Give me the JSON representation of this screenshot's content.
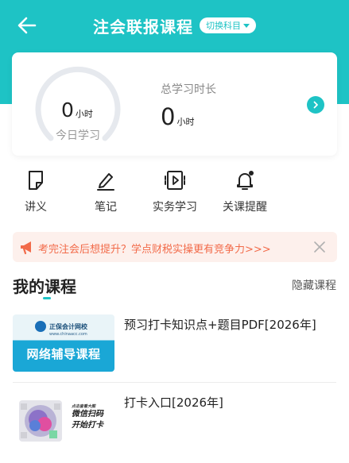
{
  "header": {
    "title": "注会联报课程",
    "switch_label": "切换科目",
    "colors": {
      "brand": "#1ec3c5"
    }
  },
  "stats": {
    "today_value": "0",
    "today_unit": "小时",
    "today_label": "今日学习",
    "total_label": "总学习时长",
    "total_value": "0",
    "total_unit": "小时"
  },
  "actions": [
    {
      "label": "讲义",
      "icon": "handout-icon"
    },
    {
      "label": "笔记",
      "icon": "pencil-icon"
    },
    {
      "label": "实务学习",
      "icon": "video-play-icon"
    },
    {
      "label": "关课提醒",
      "icon": "bell-icon"
    }
  ],
  "banner": {
    "text": "考完注会后想提升？学点财税实操更有竞争力>>>",
    "colors": {
      "bg": "#fdf0ec",
      "text": "#f26b4a"
    }
  },
  "courses_section": {
    "title": "我的课程",
    "hide_label": "隐藏课程"
  },
  "courses": [
    {
      "title": "预习打卡知识点+题目PDF[2026年]",
      "thumb_logo": "正保会计网校",
      "thumb_url": "www.chinaacc.com",
      "thumb_caption": "网络辅导课程"
    },
    {
      "title": "打卡入口[2026年]",
      "thumb_small": "点击查看大图",
      "thumb_line1": "微信扫码",
      "thumb_line2": "开始打卡"
    }
  ]
}
